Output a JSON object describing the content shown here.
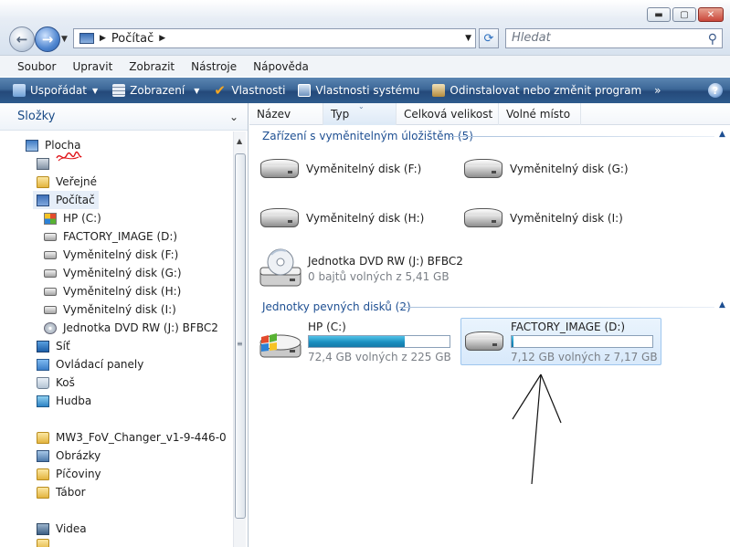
{
  "window": {
    "minimize_icon": "minimize-icon",
    "maximize_icon": "maximize-icon",
    "close_icon": "close-icon"
  },
  "nav": {
    "back_icon": "back-arrow-icon",
    "forward_icon": "forward-arrow-icon",
    "address": "Počítač",
    "search_placeholder": "Hledat"
  },
  "menu": [
    "Soubor",
    "Upravit",
    "Zobrazit",
    "Nástroje",
    "Nápověda"
  ],
  "toolbar": {
    "organize": "Uspořádat",
    "views": "Zobrazení",
    "properties": "Vlastnosti",
    "system_properties": "Vlastnosti systému",
    "uninstall": "Odinstalovat nebo změnit program",
    "more": "»",
    "help": "?"
  },
  "sidebar": {
    "title": "Složky",
    "items": [
      {
        "label": "Plocha"
      },
      {
        "label": ""
      },
      {
        "label": "Veřejné"
      },
      {
        "label": "Počítač"
      },
      {
        "label": "HP (C:)"
      },
      {
        "label": "FACTORY_IMAGE (D:)"
      },
      {
        "label": "Vyměnitelný disk (F:)"
      },
      {
        "label": "Vyměnitelný disk (G:)"
      },
      {
        "label": "Vyměnitelný disk (H:)"
      },
      {
        "label": "Vyměnitelný disk (I:)"
      },
      {
        "label": "Jednotka DVD RW (J:) BFBC2"
      },
      {
        "label": "Síť"
      },
      {
        "label": "Ovládací panely"
      },
      {
        "label": "Koš"
      },
      {
        "label": "Hudba"
      },
      {
        "label": "MW3_FoV_Changer_v1-9-446-0"
      },
      {
        "label": "Obrázky"
      },
      {
        "label": "Píčoviny"
      },
      {
        "label": "Tábor"
      },
      {
        "label": "Videa"
      }
    ]
  },
  "columns": [
    "Název",
    "Typ",
    "Celková velikost",
    "Volné místo"
  ],
  "groups": {
    "removable": "Zařízení s vyměnitelným úložištěm (5)",
    "hdd": "Jednotky pevných disků (2)"
  },
  "removable": [
    {
      "name": "Vyměnitelný disk (F:)"
    },
    {
      "name": "Vyměnitelný disk (G:)"
    },
    {
      "name": "Vyměnitelný disk (H:)"
    },
    {
      "name": "Vyměnitelný disk (I:)"
    }
  ],
  "dvd": {
    "name": "Jednotka DVD RW (J:) BFBC2",
    "info": "0 bajtů volných z 5,41 GB"
  },
  "hdd": [
    {
      "name": "HP (C:)",
      "info": "72,4 GB volných z 225 GB",
      "used_fraction": 0.68
    },
    {
      "name": "FACTORY_IMAGE (D:)",
      "info": "7,12 GB volných z 7,17 GB",
      "used_fraction": 0.007
    }
  ]
}
